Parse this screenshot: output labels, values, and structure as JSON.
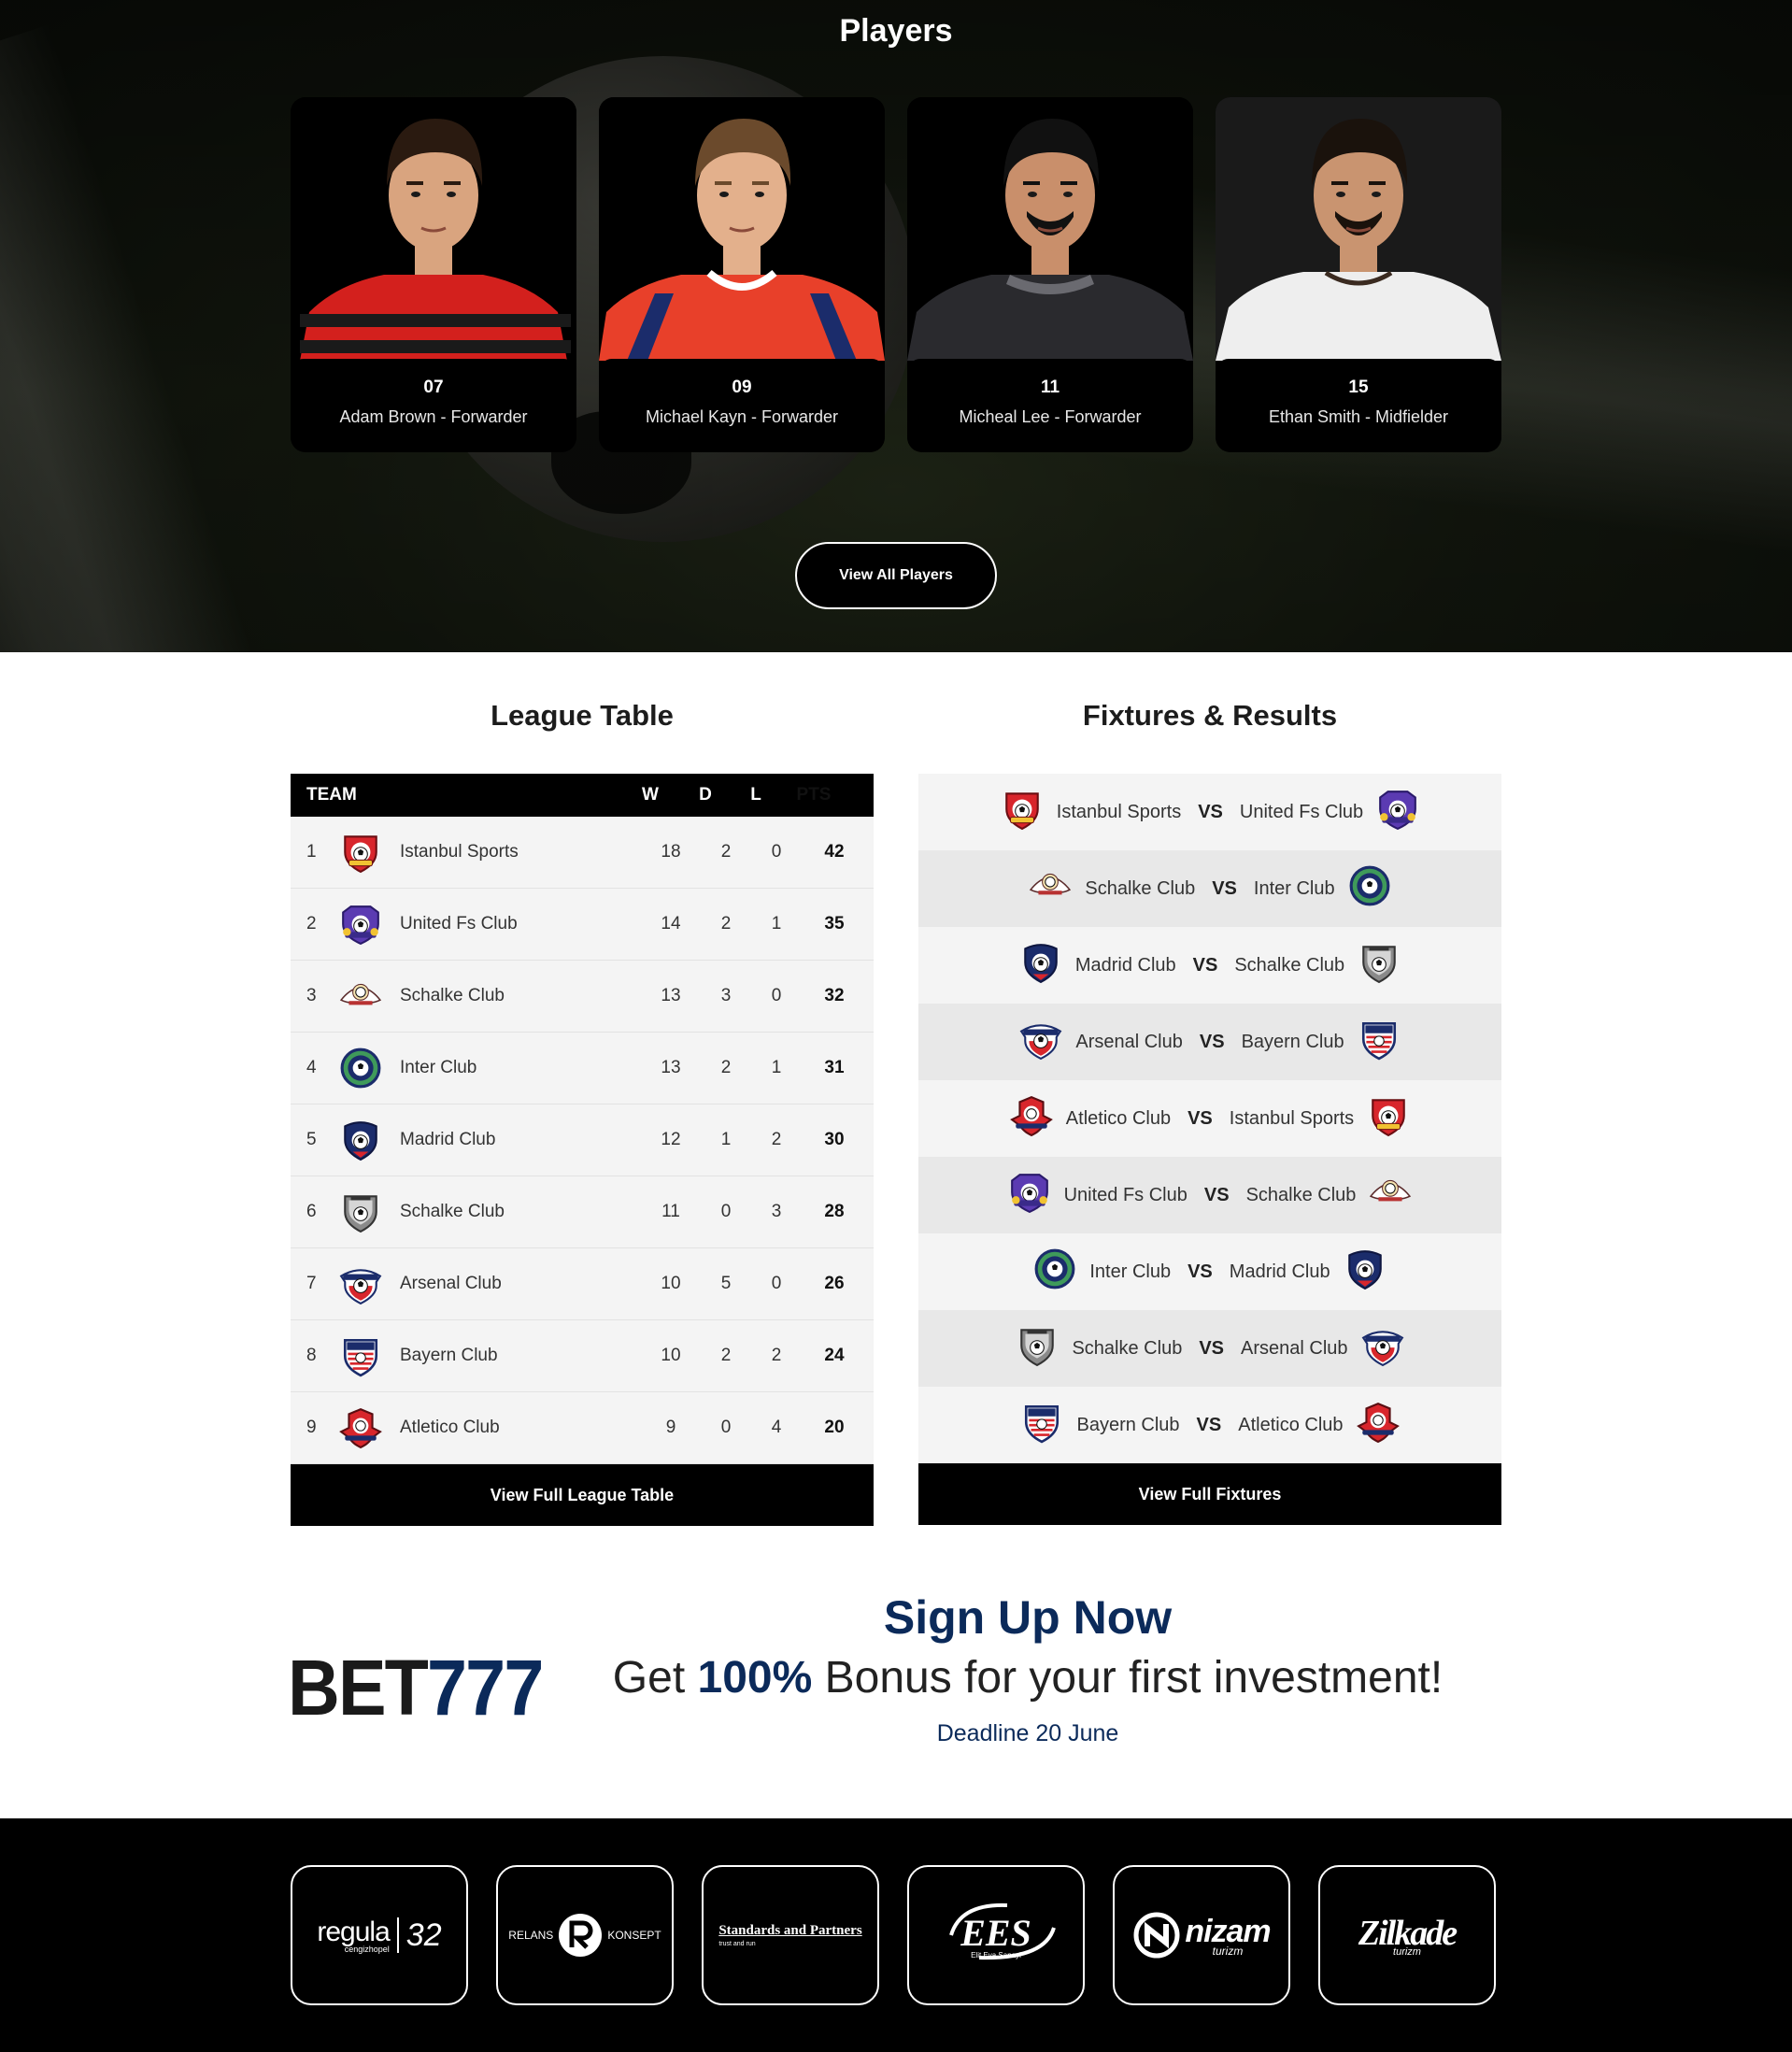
{
  "players": {
    "title": "Players",
    "cards": [
      {
        "number": "07",
        "name": "Adam Brown - Forwarder",
        "shirt": "#d3201d",
        "shirt2": "#1a1a1a"
      },
      {
        "number": "09",
        "name": "Michael Kayn - Forwarder",
        "shirt": "#e8402a",
        "shirt2": "#1b2c6b"
      },
      {
        "number": "11",
        "name": "Micheal Lee - Forwarder",
        "shirt": "#2a2a2e",
        "shirt2": "#6a6a70"
      },
      {
        "number": "15",
        "name": "Ethan Smith - Midfielder",
        "shirt": "#eeeeee",
        "shirt2": "#cfcfcf"
      }
    ],
    "view_all": "View All Players"
  },
  "league": {
    "title": "League Table",
    "headers": {
      "team": "TEAM",
      "w": "W",
      "d": "D",
      "l": "L",
      "pts": "PTS"
    },
    "rows": [
      {
        "rank": "1",
        "team": "Istanbul Sports",
        "w": "18",
        "d": "2",
        "l": "0",
        "pts": "42",
        "logo": "red"
      },
      {
        "rank": "2",
        "team": "United Fs Club",
        "w": "14",
        "d": "2",
        "l": "1",
        "pts": "35",
        "logo": "purple"
      },
      {
        "rank": "3",
        "team": "Schalke Club",
        "w": "13",
        "d": "3",
        "l": "0",
        "pts": "32",
        "logo": "wing"
      },
      {
        "rank": "4",
        "team": "Inter Club",
        "w": "13",
        "d": "2",
        "l": "1",
        "pts": "31",
        "logo": "blue"
      },
      {
        "rank": "5",
        "team": "Madrid Club",
        "w": "12",
        "d": "1",
        "l": "2",
        "pts": "30",
        "logo": "navy"
      },
      {
        "rank": "6",
        "team": "Schalke Club",
        "w": "11",
        "d": "0",
        "l": "3",
        "pts": "28",
        "logo": "grey"
      },
      {
        "rank": "7",
        "team": "Arsenal Club",
        "w": "10",
        "d": "5",
        "l": "0",
        "pts": "26",
        "logo": "arsenal"
      },
      {
        "rank": "8",
        "team": "Bayern Club",
        "w": "10",
        "d": "2",
        "l": "2",
        "pts": "24",
        "logo": "stripes"
      },
      {
        "rank": "9",
        "team": "Atletico Club",
        "w": "9",
        "d": "0",
        "l": "4",
        "pts": "20",
        "logo": "redwing"
      }
    ],
    "view_full": "View Full League Table"
  },
  "fixtures": {
    "title": "Fixtures & Results",
    "vs": "VS",
    "matches": [
      {
        "home": "Istanbul Sports",
        "home_logo": "red",
        "away": "United Fs Club",
        "away_logo": "purple"
      },
      {
        "home": "Schalke Club",
        "home_logo": "wing",
        "away": "Inter Club",
        "away_logo": "blue"
      },
      {
        "home": "Madrid Club",
        "home_logo": "navy",
        "away": "Schalke Club",
        "away_logo": "grey"
      },
      {
        "home": "Arsenal Club",
        "home_logo": "arsenal",
        "away": "Bayern Club",
        "away_logo": "stripes"
      },
      {
        "home": "Atletico Club",
        "home_logo": "redwing",
        "away": "Istanbul Sports",
        "away_logo": "red"
      },
      {
        "home": "United Fs Club",
        "home_logo": "purple",
        "away": "Schalke Club",
        "away_logo": "wing"
      },
      {
        "home": "Inter Club",
        "home_logo": "blue",
        "away": "Madrid Club",
        "away_logo": "navy"
      },
      {
        "home": "Schalke Club",
        "home_logo": "grey",
        "away": "Arsenal Club",
        "away_logo": "arsenal"
      },
      {
        "home": "Bayern Club",
        "home_logo": "stripes",
        "away": "Atletico Club",
        "away_logo": "redwing"
      }
    ],
    "view_full": "View Full Fixtures"
  },
  "promo": {
    "logo_part1": "BET",
    "logo_part2": "777",
    "headline": "Sign Up Now",
    "sub_pre": "Get ",
    "sub_bold": "100%",
    "sub_post": " Bonus for your first investment!",
    "deadline": "Deadline 20 June"
  },
  "sponsors": [
    {
      "name": "regula",
      "sub": "cengizhopel",
      "extra": "32"
    },
    {
      "name_left": "RELANS",
      "name_right": "KONSEPT"
    },
    {
      "name": "Standards and Partners",
      "sub": "trust and run"
    },
    {
      "name": "EES",
      "sub": "Elit Eva Sanayi"
    },
    {
      "name": "nizam",
      "sub": "turizm"
    },
    {
      "name": "Zilkade",
      "sub": "turizm"
    }
  ]
}
